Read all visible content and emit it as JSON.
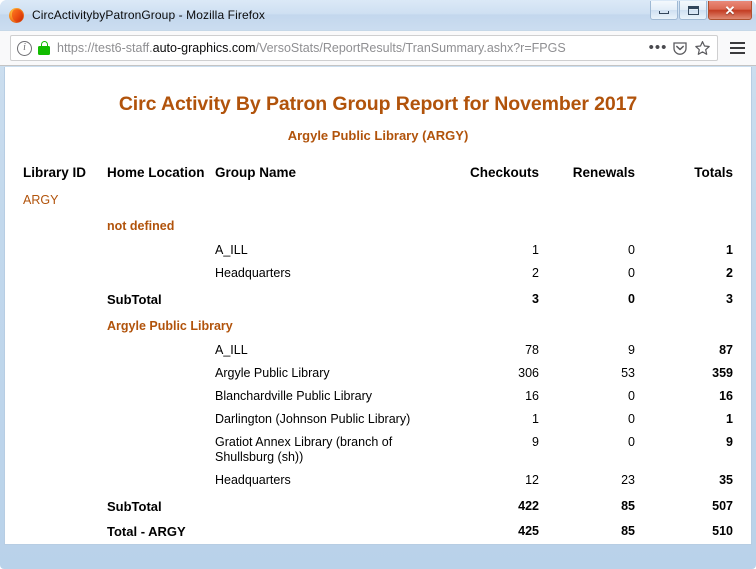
{
  "window": {
    "title": "CircActivitybyPatronGroup - Mozilla Firefox",
    "app_icon": "firefox-icon",
    "minimize_label": "–",
    "maximize_label": "□",
    "close_label": "✕"
  },
  "toolbar": {
    "identity_icon": "info-circle-icon",
    "security_icon": "lock-icon",
    "url_prefix": "https://test6-staff.",
    "url_host": "auto-graphics.com",
    "url_path": "/VersoStats/ReportResults/TranSummary.ashx?r=FPGS",
    "url_full": "https://test6-staff.auto-graphics.com/VersoStats/ReportResults/TranSummary.ashx?r=FPGS",
    "page_actions_label": "•••",
    "pocket_icon": "pocket-shield-icon",
    "bookmark_icon": "star-icon",
    "menu_icon": "hamburger-menu-icon"
  },
  "report": {
    "title": "Circ Activity By Patron Group Report for November 2017",
    "subtitle": "Argyle Public Library (ARGY)",
    "accent_color": "#b1530b",
    "columns": {
      "library_id": "Library ID",
      "home_location": "Home Location",
      "group_name": "Group Name",
      "checkouts": "Checkouts",
      "renewals": "Renewals",
      "totals": "Totals"
    },
    "library_id_value": "ARGY",
    "sections": [
      {
        "home_location": "not defined",
        "rows": [
          {
            "group_name": "A_ILL",
            "checkouts": "1",
            "renewals": "0",
            "totals": "1"
          },
          {
            "group_name": "Headquarters",
            "checkouts": "2",
            "renewals": "0",
            "totals": "2"
          }
        ],
        "subtotal": {
          "label": "SubTotal",
          "checkouts": "3",
          "renewals": "0",
          "totals": "3"
        }
      },
      {
        "home_location": "Argyle Public Library",
        "rows": [
          {
            "group_name": "A_ILL",
            "checkouts": "78",
            "renewals": "9",
            "totals": "87"
          },
          {
            "group_name": "Argyle Public Library",
            "checkouts": "306",
            "renewals": "53",
            "totals": "359"
          },
          {
            "group_name": "Blanchardville Public Library",
            "checkouts": "16",
            "renewals": "0",
            "totals": "16"
          },
          {
            "group_name": "Darlington (Johnson Public Library)",
            "checkouts": "1",
            "renewals": "0",
            "totals": "1"
          },
          {
            "group_name": "Gratiot Annex Library (branch of Shullsburg (sh))",
            "checkouts": "9",
            "renewals": "0",
            "totals": "9"
          },
          {
            "group_name": "Headquarters",
            "checkouts": "12",
            "renewals": "23",
            "totals": "35"
          }
        ],
        "subtotal": {
          "label": "SubTotal",
          "checkouts": "422",
          "renewals": "85",
          "totals": "507"
        }
      }
    ],
    "grand_total": {
      "label": "Total - ARGY",
      "checkouts": "425",
      "renewals": "85",
      "totals": "510"
    }
  }
}
